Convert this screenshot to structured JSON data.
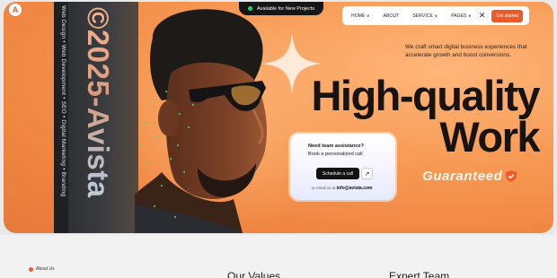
{
  "header": {
    "logo_letter": "A",
    "availability": "Available for New Projects",
    "nav": {
      "home": "HOME ∨",
      "about": "ABOUT",
      "service": "SERVICE ∨",
      "pages": "PAGES ∨",
      "close": "✕",
      "contact": "Get started"
    }
  },
  "sidebar": {
    "services_text": "Web Design • Web Development • SEO • Digital Marketing • Branding",
    "brand_text": "©2025-Avista"
  },
  "hero": {
    "tagline": "We craft smart digital business experiences that accelerate growth and boost conversions.",
    "headline_line1": "High-quality",
    "headline_line2": "Work",
    "guaranteed": "Guaranteed",
    "cta": {
      "title": "Need team assistance?",
      "subtitle": "Book a personalized call",
      "button": "Schedule a call",
      "arrow": "↗",
      "email_prefix": "or email us at",
      "email": "info@avista.com"
    }
  },
  "lower": {
    "about_label": "About Us",
    "values_heading": "Our Values",
    "team_heading": "Expert Team"
  },
  "colors": {
    "accent": "#ec5a2a",
    "hero_bg": "#f79a55",
    "dark": "#161616",
    "online_dot": "#2fd36b"
  }
}
